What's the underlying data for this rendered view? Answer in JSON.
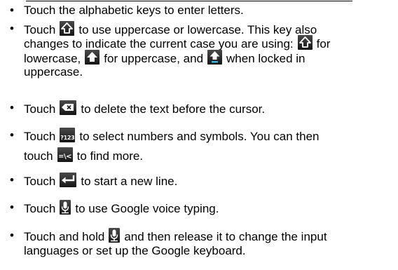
{
  "bullets": {
    "b1": {
      "text": "Touch the alphabetic keys to enter letters."
    },
    "b2": {
      "line1_before": "Touch",
      "line1_after": "to use uppercase or lowercase. This key also",
      "line2_before": "changes to indicate the current case you are using:",
      "line2_after": "for",
      "line3_before": "lowercase,",
      "line3_mid": "for uppercase, and",
      "line3_after": "when locked in",
      "line4": "uppercase."
    },
    "b3": {
      "before": "Touch",
      "after": "to delete the text before the cursor."
    },
    "b4": {
      "before": "Touch",
      "after": "to select numbers and symbols. You can then",
      "line2_before": "touch",
      "line2_after": "to find more."
    },
    "b5": {
      "before": "Touch",
      "after": "to start a new line."
    },
    "b6": {
      "before": "Touch",
      "after": "to use Google voice typing."
    },
    "b7": {
      "before": "Touch and hold",
      "after": "and then release it to change the input",
      "line2": "languages or set up the Google keyboard."
    }
  },
  "keys": {
    "numbers_key_label": "?123",
    "symbols_key_label": "=\\<"
  },
  "icons": {
    "shift": "shift-key-icon",
    "shift_lower": "shift-lowercase-icon",
    "shift_upper": "shift-uppercase-icon",
    "shift_locked": "shift-locked-icon",
    "delete": "delete-key-icon",
    "numbers": "numbers-symbols-key-icon",
    "more_symbols": "more-symbols-key-icon",
    "enter": "enter-key-icon",
    "microphone": "microphone-key-icon"
  },
  "colors": {
    "key_background": "#2a2a2a",
    "key_glyph": "#ffffff",
    "shift_active": "#ffffff",
    "shift_locked_bar": "#33b5e5"
  }
}
